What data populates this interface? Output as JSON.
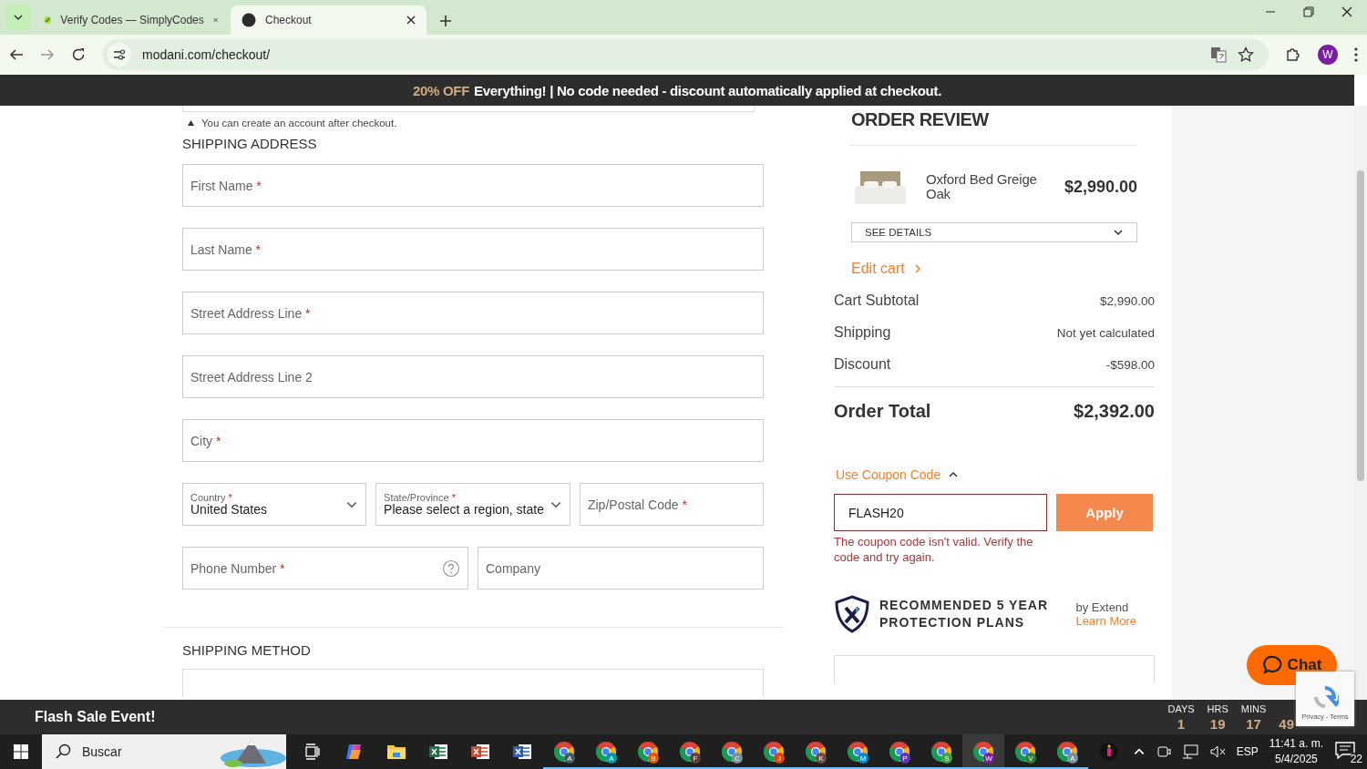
{
  "browser": {
    "tabs": [
      {
        "title": "Verify Codes — SimplyCodes",
        "selected": false
      },
      {
        "title": "Checkout",
        "selected": true
      }
    ],
    "url": "modani.com/checkout/",
    "profile_initial": "W"
  },
  "promo_banner": {
    "highlight": "20% OFF",
    "text": "Everything! | No code needed - discount automatically applied at checkout."
  },
  "account_note": "You can create an account after checkout.",
  "shipping_address": {
    "heading": "SHIPPING ADDRESS",
    "required_mark": "*",
    "rows": [
      [
        {
          "kind": "text",
          "label": "First Name",
          "required": true
        }
      ],
      [
        {
          "kind": "text",
          "label": "Last Name",
          "required": true
        }
      ],
      [
        {
          "kind": "text",
          "label": "Street Address Line",
          "required": true
        }
      ],
      [
        {
          "kind": "text",
          "label": "Street Address Line 2",
          "required": false
        }
      ],
      [
        {
          "kind": "text",
          "label": "City",
          "required": true
        }
      ],
      [
        {
          "kind": "select",
          "label": "Country",
          "required": true,
          "value": "United States"
        },
        {
          "kind": "select",
          "label": "State/Province",
          "required": true,
          "value": "Please select a region, state"
        },
        {
          "kind": "text",
          "label": "Zip/Postal Code",
          "required": true
        }
      ],
      [
        {
          "kind": "help",
          "label": "Phone Number",
          "required": true
        },
        {
          "kind": "text",
          "label": "Company",
          "required": false
        }
      ]
    ]
  },
  "shipping_method": {
    "heading": "SHIPPING METHOD"
  },
  "order_review": {
    "heading": "ORDER REVIEW",
    "item": {
      "name": "Oxford Bed Greige Oak",
      "price": "$2,990.00"
    },
    "see_details": "SEE DETAILS",
    "edit_cart": "Edit cart",
    "totals": [
      {
        "label": "Cart Subtotal",
        "value": "$2,990.00"
      },
      {
        "label": "Shipping",
        "value": "Not yet calculated"
      },
      {
        "label": "Discount",
        "value": "-$598.00"
      }
    ],
    "order_total": {
      "label": "Order Total",
      "value": "$2,392.00"
    },
    "coupon": {
      "toggle": "Use Coupon Code",
      "expanded": true,
      "value": "FLASH20",
      "button": "Apply",
      "error": "The coupon code isn't valid. Verify the code and try again."
    },
    "protection": {
      "title": "RECOMMENDED 5 YEAR PROTECTION PLANS",
      "by": "by Extend",
      "link": "Learn More"
    }
  },
  "chat": {
    "label": "Chat"
  },
  "recaptcha": {
    "links": "Privacy - Terms"
  },
  "flash_bar": {
    "title": "Flash Sale Event!",
    "countdown": [
      {
        "unit": "DAYS",
        "value": "1"
      },
      {
        "unit": "HRS",
        "value": "19"
      },
      {
        "unit": "MINS",
        "value": "17"
      },
      {
        "value": "49"
      }
    ]
  },
  "taskbar": {
    "search_placeholder": "Buscar",
    "apps": [
      {
        "kind": "taskview"
      },
      {
        "kind": "copilot"
      },
      {
        "kind": "folder"
      },
      {
        "kind": "excel"
      },
      {
        "kind": "powerpoint"
      },
      {
        "kind": "word"
      },
      {
        "kind": "chrome",
        "badge": "A",
        "color": "#455a64",
        "selected": false
      },
      {
        "kind": "chrome",
        "badge": "A",
        "color": "#0097a7",
        "selected": false
      },
      {
        "kind": "chrome",
        "badge": "B",
        "color": "#e65100",
        "selected": false
      },
      {
        "kind": "chrome",
        "badge": "F",
        "color": "#5d4037",
        "selected": false
      },
      {
        "kind": "chrome",
        "badge": "C",
        "color": "#78909c",
        "selected": false
      },
      {
        "kind": "chrome",
        "badge": "J",
        "color": "#d84315",
        "selected": false
      },
      {
        "kind": "chrome",
        "badge": "K",
        "color": "#6d4c41",
        "selected": false
      },
      {
        "kind": "chrome",
        "badge": "M",
        "color": "#0288d1",
        "selected": false
      },
      {
        "kind": "chrome",
        "badge": "P",
        "color": "#5e35b1",
        "selected": false
      },
      {
        "kind": "chrome",
        "badge": "S",
        "color": "#43a047",
        "selected": false
      },
      {
        "kind": "chrome",
        "badge": "W",
        "color": "#7b1fa2",
        "selected": true
      },
      {
        "kind": "chrome",
        "badge": "V",
        "color": "#2e7d32",
        "selected": false
      },
      {
        "kind": "chrome",
        "badge": "A",
        "color": "#78909c",
        "selected": false
      },
      {
        "kind": "app"
      }
    ],
    "language": "ESP",
    "time": "11:41 a. m.",
    "date": "5/4/2025",
    "notifications": "22"
  }
}
